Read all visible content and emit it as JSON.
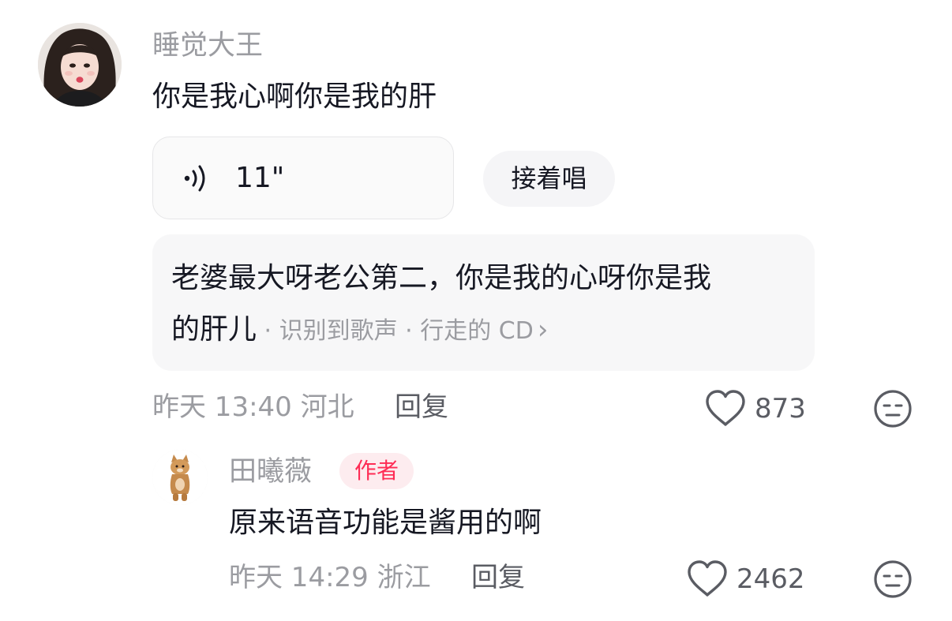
{
  "comment": {
    "username": "睡觉大王",
    "text": "你是我心啊你是我的肝",
    "voice": {
      "duration": "11\"",
      "icon": "voice-wave-icon"
    },
    "sing_along_label": "接着唱",
    "lyrics": {
      "line1": "老婆最大呀老公第二，你是我的心呀你是我",
      "line2": "的肝儿",
      "meta": " · 识别到歌声 · 行走的 CD",
      "chevron": "›"
    },
    "time_location": "昨天 13:40 河北",
    "reply_label": "回复",
    "like_count": "873"
  },
  "reply": {
    "username": "田曦薇",
    "badge": "作者",
    "text": "原来语音功能是酱用的啊",
    "time_location": "昨天 14:29 浙江",
    "reply_label": "回复",
    "like_count": "2462"
  },
  "colors": {
    "primary_text": "#161823",
    "secondary_text": "#9b9ca1",
    "author_badge_bg": "#fdecef",
    "author_badge_text": "#fe2c55",
    "lyrics_bg": "#f7f7f8"
  }
}
